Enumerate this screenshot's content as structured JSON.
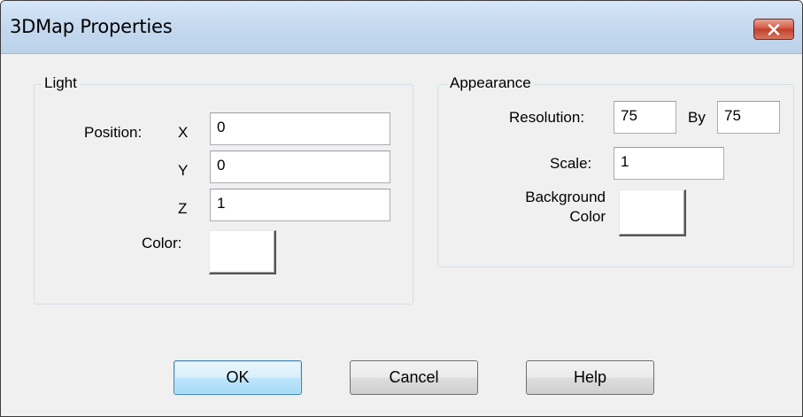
{
  "window": {
    "title": "3DMap Properties",
    "close_icon": "close-icon"
  },
  "light": {
    "legend": "Light",
    "position_label": "Position:",
    "x_label": "X",
    "y_label": "Y",
    "z_label": "Z",
    "x_value": "0",
    "y_value": "0",
    "z_value": "1",
    "color_label": "Color:",
    "color_value": "#ffffff"
  },
  "appearance": {
    "legend": "Appearance",
    "resolution_label": "Resolution:",
    "resolution_x": "75",
    "by_label": "By",
    "resolution_y": "75",
    "scale_label": "Scale:",
    "scale_value": "1",
    "background_label_line1": "Background",
    "background_label_line2": "Color",
    "background_color_value": "#ffffff"
  },
  "buttons": {
    "ok": "OK",
    "cancel": "Cancel",
    "help": "Help"
  }
}
